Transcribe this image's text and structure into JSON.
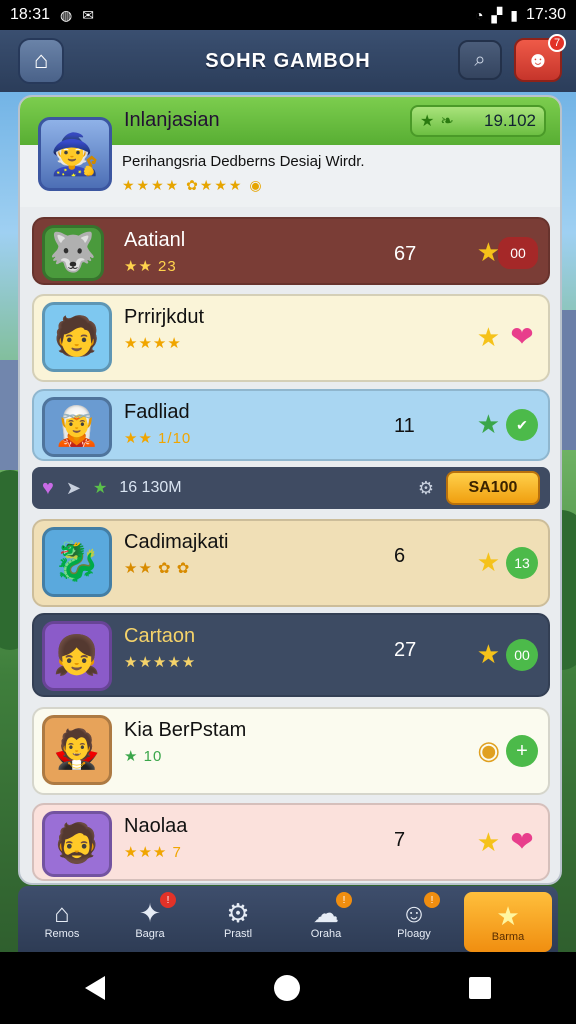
{
  "status": {
    "left_time": "18:31",
    "right_time": "17:30"
  },
  "header": {
    "title": "SOHR GAMBOH",
    "notif_count": "7"
  },
  "hero": {
    "name": "Inlanjasian",
    "score": "19.102",
    "subtitle": "Perihangsria Dedberns Desiaj Wirdr.",
    "stars": "★★★★ ✿★★★ ◉"
  },
  "rows": [
    {
      "name": "Aatianl",
      "stars": "★★ 23",
      "num": "67",
      "badge": "00",
      "avatar": "🐺"
    },
    {
      "name": "Prrirjkdut",
      "stars": "★★★★",
      "num": "",
      "badge": "❤",
      "avatar": "🧑"
    },
    {
      "name": "Fadliad",
      "stars": "★★ 1/10",
      "num": "11",
      "badge": "✔",
      "avatar": "🧝"
    },
    {
      "name": "Cadimajkati",
      "stars": "★★ ✿ ✿",
      "num": "6",
      "badge": "13",
      "avatar": "🐉"
    },
    {
      "name": "Cartaon",
      "stars": "★★★★★",
      "num": "27",
      "badge": "00",
      "avatar": "👧"
    },
    {
      "name": "Kia BerPstam",
      "stars": "★ 10",
      "num": "",
      "badge": "+",
      "avatar": "🧛"
    },
    {
      "name": "Naolaa",
      "stars": "★★★ 7",
      "num": "7",
      "badge": "❤",
      "avatar": "🧔"
    }
  ],
  "tool": {
    "value": "16 130M",
    "button": "SA100"
  },
  "nav": [
    {
      "label": "Remos",
      "icon": "⌂",
      "badge": ""
    },
    {
      "label": "Bagra",
      "icon": "✦",
      "badge": "!"
    },
    {
      "label": "Prastl",
      "icon": "⚙",
      "badge": ""
    },
    {
      "label": "Oraha",
      "icon": "☁",
      "badge": "!"
    },
    {
      "label": "Ploagy",
      "icon": "☺",
      "badge": "!"
    },
    {
      "label": "Barma",
      "icon": "★",
      "badge": ""
    }
  ]
}
